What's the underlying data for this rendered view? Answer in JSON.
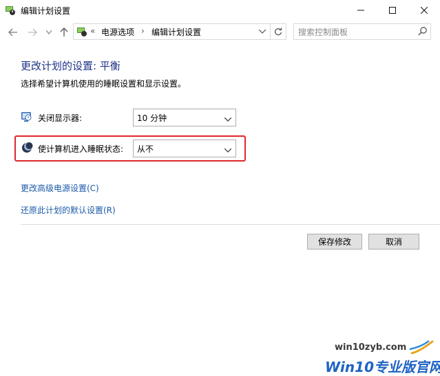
{
  "window": {
    "title": "编辑计划设置",
    "icon": "power-options-icon",
    "controls": [
      "minimize-icon",
      "maximize-icon",
      "close-icon"
    ]
  },
  "nav": {
    "buttons": [
      "back-arrow-icon",
      "forward-arrow-icon",
      "recent-dropdown-icon",
      "up-arrow-icon"
    ],
    "breadcrumb_prefix": "«",
    "breadcrumb": [
      "电源选项",
      "编辑计划设置"
    ],
    "breadcrumb_separator": "›",
    "search_placeholder": "搜索控制面板"
  },
  "main": {
    "heading": "更改计划的设置: 平衡",
    "description": "选择希望计算机使用的睡眠设置和显示设置。",
    "settings": [
      {
        "label": "关闭显示器:",
        "value": "10 分钟",
        "icon": "monitor-icon"
      },
      {
        "label": "使计算机进入睡眠状态:",
        "value": "从不",
        "icon": "moon-icon"
      }
    ],
    "links": [
      "更改高级电源设置(C)",
      "还原此计划的默认设置(R)"
    ]
  },
  "footer": {
    "save_label": "保存修改",
    "cancel_label": "取消"
  },
  "watermark": {
    "url": "win10zyb.com",
    "brand": "Win10专业版官网"
  },
  "colors": {
    "heading": "#1e3287",
    "link": "#1a5aa8",
    "highlight_border": "#e0262a",
    "watermark_brand": "#1e63c4"
  }
}
